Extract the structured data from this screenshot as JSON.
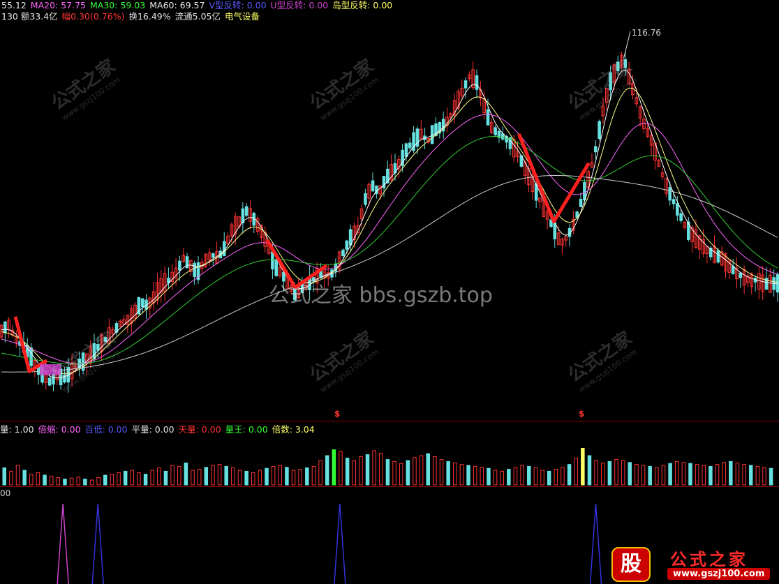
{
  "header": {
    "line1": [
      {
        "text": "55.12",
        "color": "#e6e6e6"
      },
      {
        "text": "MA20: 57.75",
        "color": "#ff66ff"
      },
      {
        "text": "MA30: 59.03",
        "color": "#33ff33"
      },
      {
        "text": "MA60: 69.57",
        "color": "#e6e6e6"
      },
      {
        "text": "V型反转: 0.00",
        "color": "#5a5aff"
      },
      {
        "text": "U型反转: 0.00",
        "color": "#cc44cc"
      },
      {
        "text": "岛型反转: 0.00",
        "color": "#ffff66"
      }
    ],
    "line2": [
      {
        "text": "130 额33.4亿",
        "color": "#e6e6e6"
      },
      {
        "text": "幅0.30(0.76%)",
        "color": "#ff3333"
      },
      {
        "text": "换16.49%",
        "color": "#e6e6e6"
      },
      {
        "text": "流通5.05亿",
        "color": "#e6e6e6"
      },
      {
        "text": "电气设备",
        "color": "#ffff66"
      }
    ]
  },
  "volume_legend": [
    {
      "text": "量: 1.00",
      "color": "#e6e6e6"
    },
    {
      "text": "倍缩: 0.00",
      "color": "#ff66ff"
    },
    {
      "text": "百低: 0.00",
      "color": "#5a5aff"
    },
    {
      "text": "平量: 0.00",
      "color": "#e6e6e6"
    },
    {
      "text": "天量: 0.00",
      "color": "#ff3333"
    },
    {
      "text": "量王: 0.00",
      "color": "#33ff33"
    },
    {
      "text": "倍数: 3.04",
      "color": "#ffff66"
    }
  ],
  "indicator_label": "00",
  "peak_label": "116.76",
  "signal_marks": [
    "$",
    "$"
  ],
  "watermarks": {
    "overlay_text": "公式之家 bbs.gszb.top",
    "tile_text": "公式之家",
    "tile_url": "www.gszj100.com"
  },
  "logo": {
    "badge": "股",
    "title": "公式之家",
    "url": "www.gszj100.com"
  },
  "colors": {
    "up": "#ff3333",
    "down": "#66e0e0",
    "ma5": "#ffffff",
    "ma10": "#ffff88",
    "ma20": "#ff66ff",
    "ma30": "#33cc33",
    "ma60": "#cccccc",
    "v_mark": "#ff2020",
    "spike_magenta": "#cc44cc",
    "spike_blue": "#3333dd"
  },
  "chart_data": {
    "type": "line",
    "title": "",
    "series": [
      {
        "name": "MA20",
        "last": 57.75
      },
      {
        "name": "MA30",
        "last": 59.03
      },
      {
        "name": "MA60",
        "last": 69.57
      }
    ],
    "price_path": [
      [
        0,
        42
      ],
      [
        10,
        44
      ],
      [
        20,
        40
      ],
      [
        30,
        38
      ],
      [
        40,
        36
      ],
      [
        50,
        32
      ],
      [
        60,
        30
      ],
      [
        70,
        28
      ],
      [
        80,
        30
      ],
      [
        90,
        29
      ],
      [
        100,
        31
      ],
      [
        110,
        33
      ],
      [
        120,
        34
      ],
      [
        130,
        36
      ],
      [
        140,
        38
      ],
      [
        150,
        40
      ],
      [
        160,
        42
      ],
      [
        170,
        44
      ],
      [
        180,
        45
      ],
      [
        190,
        47
      ],
      [
        200,
        50
      ],
      [
        210,
        49
      ],
      [
        220,
        52
      ],
      [
        230,
        55
      ],
      [
        240,
        56
      ],
      [
        250,
        58
      ],
      [
        260,
        62
      ],
      [
        270,
        60
      ],
      [
        280,
        58
      ],
      [
        290,
        61
      ],
      [
        300,
        63
      ],
      [
        310,
        62
      ],
      [
        320,
        65
      ],
      [
        330,
        70
      ],
      [
        340,
        72
      ],
      [
        350,
        75
      ],
      [
        360,
        73
      ],
      [
        370,
        70
      ],
      [
        380,
        66
      ],
      [
        390,
        60
      ],
      [
        400,
        58
      ],
      [
        410,
        55
      ],
      [
        420,
        52
      ],
      [
        430,
        54
      ],
      [
        440,
        55
      ],
      [
        450,
        57
      ],
      [
        460,
        58
      ],
      [
        470,
        57
      ],
      [
        480,
        60
      ],
      [
        490,
        64
      ],
      [
        500,
        68
      ],
      [
        510,
        70
      ],
      [
        520,
        78
      ],
      [
        530,
        82
      ],
      [
        540,
        80
      ],
      [
        550,
        84
      ],
      [
        560,
        86
      ],
      [
        570,
        88
      ],
      [
        580,
        92
      ],
      [
        590,
        94
      ],
      [
        600,
        96
      ],
      [
        610,
        94
      ],
      [
        620,
        97
      ],
      [
        630,
        98
      ],
      [
        640,
        100
      ],
      [
        650,
        104
      ],
      [
        660,
        108
      ],
      [
        670,
        112
      ],
      [
        680,
        110
      ],
      [
        690,
        104
      ],
      [
        700,
        98
      ],
      [
        710,
        96
      ],
      [
        720,
        95
      ],
      [
        730,
        93
      ],
      [
        740,
        90
      ],
      [
        750,
        86
      ],
      [
        760,
        82
      ],
      [
        770,
        78
      ],
      [
        780,
        74
      ],
      [
        790,
        70
      ],
      [
        800,
        66
      ],
      [
        810,
        68
      ],
      [
        820,
        72
      ],
      [
        830,
        78
      ],
      [
        840,
        84
      ],
      [
        850,
        92
      ],
      [
        860,
        102
      ],
      [
        870,
        110
      ],
      [
        880,
        114
      ],
      [
        890,
        116.76
      ],
      [
        900,
        110
      ],
      [
        910,
        104
      ],
      [
        920,
        98
      ],
      [
        930,
        94
      ],
      [
        940,
        88
      ],
      [
        950,
        82
      ],
      [
        960,
        78
      ],
      [
        970,
        74
      ],
      [
        980,
        70
      ],
      [
        990,
        68
      ],
      [
        1000,
        66
      ],
      [
        1010,
        64
      ],
      [
        1020,
        63
      ],
      [
        1030,
        62
      ],
      [
        1040,
        60
      ],
      [
        1050,
        58
      ],
      [
        1060,
        57
      ],
      [
        1070,
        56
      ],
      [
        1080,
        56
      ],
      [
        1090,
        55
      ],
      [
        1100,
        55
      ],
      [
        1110,
        55.12
      ]
    ],
    "ylim": [
      20,
      125
    ],
    "volume": {
      "ylim": [
        0,
        100
      ],
      "bars": [
        35,
        28,
        40,
        30,
        22,
        25,
        20,
        18,
        15,
        12,
        14,
        16,
        12,
        10,
        15,
        20,
        22,
        25,
        28,
        30,
        25,
        22,
        30,
        35,
        28,
        40,
        38,
        45,
        30,
        32,
        36,
        40,
        42,
        38,
        35,
        30,
        28,
        25,
        30,
        34,
        38,
        40,
        36,
        30,
        32,
        35,
        38,
        50,
        60,
        72,
        68,
        55,
        50,
        58,
        62,
        70,
        65,
        52,
        48,
        44,
        50,
        56,
        60,
        64,
        58,
        52,
        48,
        45,
        42,
        40,
        38,
        36,
        34,
        30,
        28,
        32,
        36,
        40,
        38,
        35,
        30,
        28,
        32,
        36,
        42,
        55,
        75,
        60,
        50,
        45,
        48,
        52,
        50,
        46,
        42,
        40,
        38,
        36,
        40,
        44,
        48,
        46,
        44,
        42,
        40,
        38,
        42,
        46,
        48,
        45,
        42,
        40,
        38,
        36,
        34
      ]
    },
    "indicator": {
      "spikes": [
        {
          "x": 88,
          "color": "magenta"
        },
        {
          "x": 138,
          "color": "blue"
        },
        {
          "x": 484,
          "color": "blue"
        },
        {
          "x": 850,
          "color": "blue"
        }
      ]
    }
  }
}
